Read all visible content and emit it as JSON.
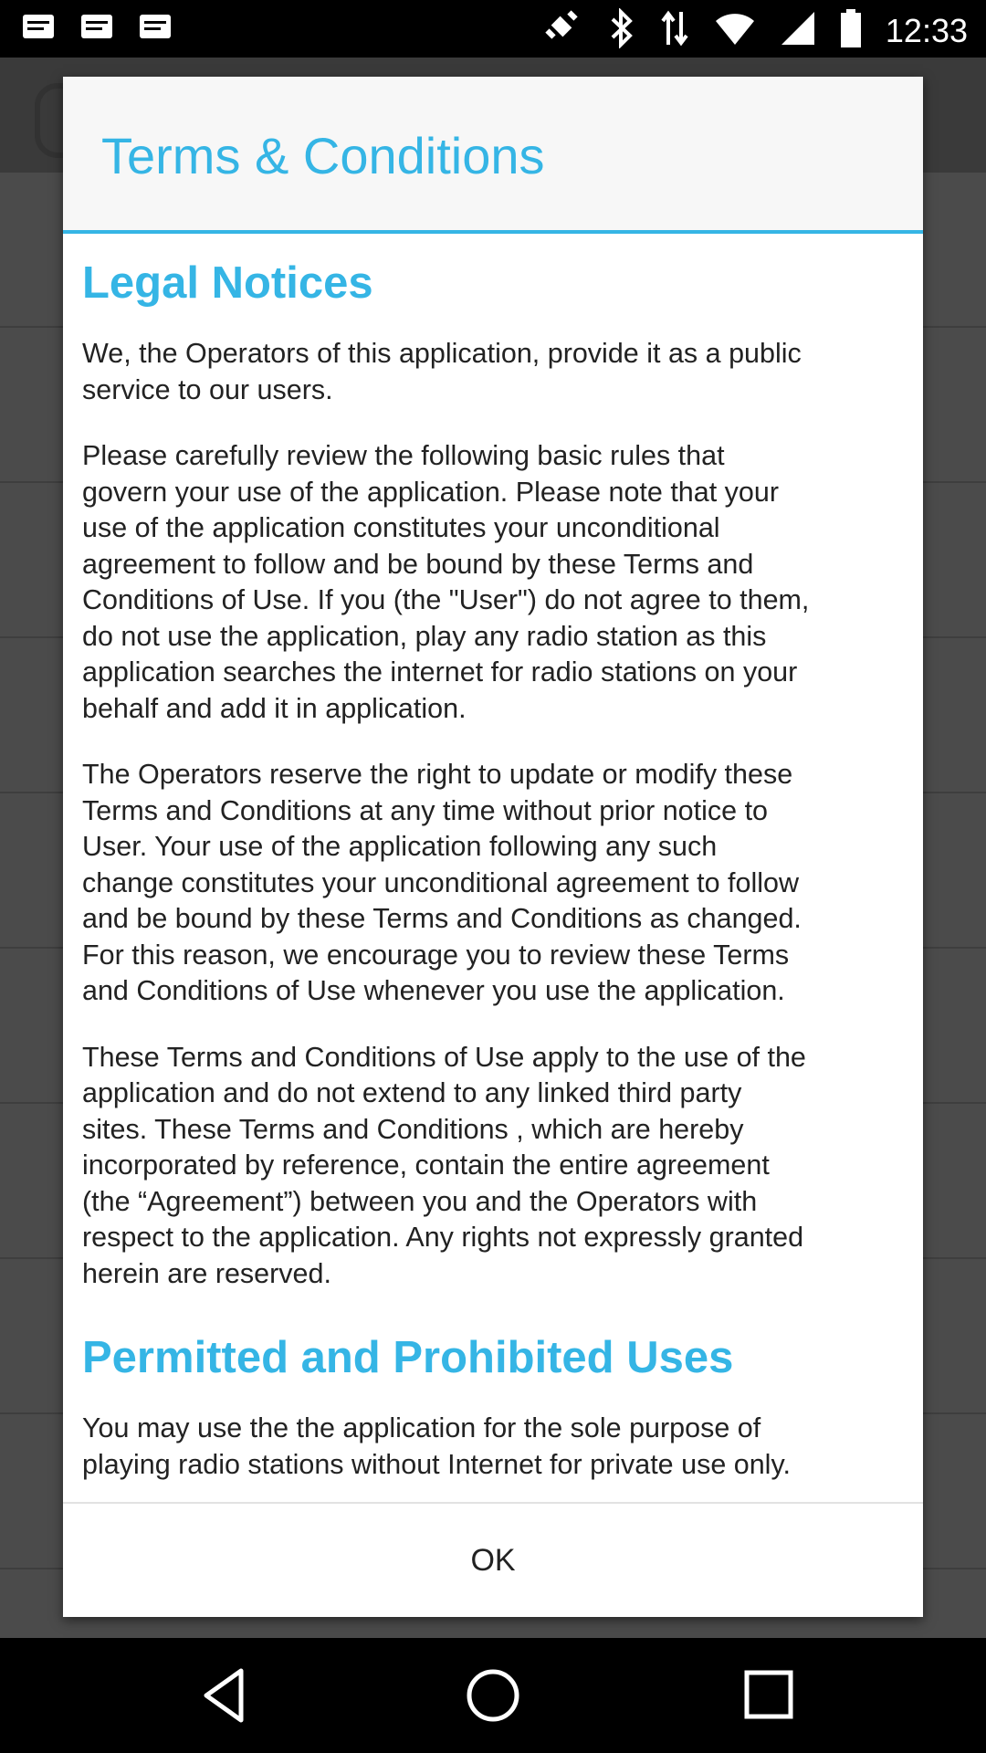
{
  "status_bar": {
    "time": "12:33",
    "icons": [
      "notification-icon",
      "notification-icon",
      "notification-icon",
      "gps-fake-icon",
      "bluetooth-icon",
      "data-arrows-icon",
      "wifi-icon",
      "signal-icon",
      "battery-icon"
    ]
  },
  "dialog": {
    "title": "Terms & Conditions",
    "sections": [
      {
        "heading": "Legal Notices",
        "paragraphs": [
          "We, the Operators of this application, provide it as a public\nservice to our users.",
          "Please carefully review the following basic rules that\ngovern your use of the application. Please note that your\nuse of the application constitutes your unconditional\nagreement to follow and be bound by these Terms and\nConditions of Use. If you (the \"User\") do not agree to them,\ndo not use the application, play any radio station as this\napplication searches the internet for radio stations on your\nbehalf and add it in application.",
          "The Operators reserve the right to update or modify these\nTerms and Conditions at any time without prior notice to\nUser. Your use of the application following any such\nchange constitutes your unconditional agreement to follow\nand be bound by these Terms and Conditions as changed.\nFor this reason, we encourage you to review these Terms\nand Conditions of Use whenever you use the application.",
          "These Terms and Conditions of Use apply to the use of the\napplication and do not extend to any linked third party\nsites. These Terms and Conditions , which are hereby\nincorporated by reference, contain the entire agreement\n(the “Agreement”) between you and the Operators with\nrespect to the application. Any rights not expressly granted\nherein are reserved."
        ]
      },
      {
        "heading": "Permitted and Prohibited Uses",
        "paragraphs": [
          "You may use the the application for the sole purpose of\nplaying radio stations without Internet for private use only."
        ]
      }
    ],
    "ok_label": "OK"
  },
  "colors": {
    "accent": "#35b5e5",
    "overlay": "#5a5a5a"
  }
}
